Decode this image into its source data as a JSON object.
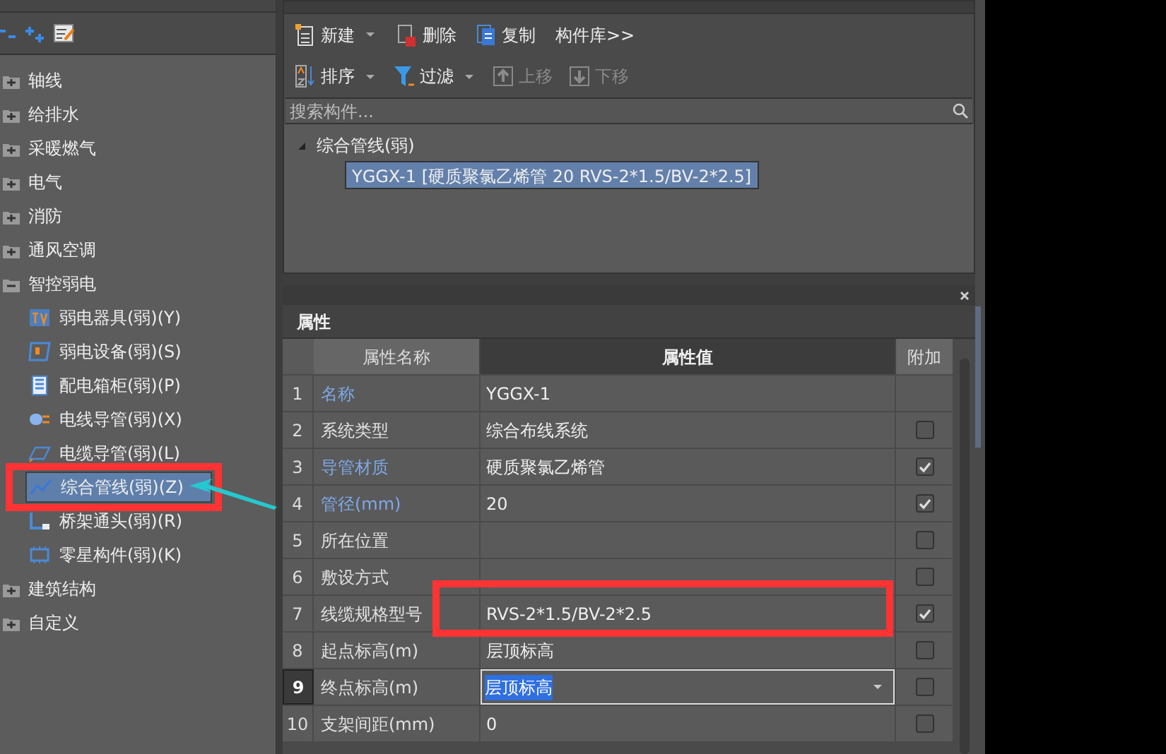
{
  "nav_toolbar": {
    "tools": [
      {
        "kind": "collapse"
      },
      {
        "kind": "expand"
      },
      {
        "kind": "edit"
      }
    ]
  },
  "nav_tree": [
    {
      "label": "轴线",
      "expanded": false
    },
    {
      "label": "给排水",
      "expanded": false
    },
    {
      "label": "采暖燃气",
      "expanded": false
    },
    {
      "label": "电气",
      "expanded": false
    },
    {
      "label": "消防",
      "expanded": false
    },
    {
      "label": "通风空调",
      "expanded": false
    },
    {
      "label": "智控弱电",
      "expanded": true,
      "children": [
        {
          "label": "弱电器具(弱)(Y)",
          "selected": false
        },
        {
          "label": "弱电设备(弱)(S)",
          "selected": false
        },
        {
          "label": "配电箱柜(弱)(P)",
          "selected": false
        },
        {
          "label": "电线导管(弱)(X)",
          "selected": false
        },
        {
          "label": "电缆导管(弱)(L)",
          "selected": false
        },
        {
          "label": "综合管线(弱)(Z)",
          "selected": true
        },
        {
          "label": "桥架通头(弱)(R)",
          "selected": false
        },
        {
          "label": "零星构件(弱)(K)",
          "selected": false
        }
      ]
    },
    {
      "label": "建筑结构",
      "expanded": false
    },
    {
      "label": "自定义",
      "expanded": false
    }
  ],
  "component_toolbar": {
    "row_1": [
      {
        "label": "新建",
        "dropdown": true,
        "disabled": false
      },
      {
        "label": "删除",
        "dropdown": false,
        "disabled": false
      },
      {
        "label": "复制",
        "dropdown": false,
        "disabled": false
      },
      {
        "label": "构件库>>",
        "dropdown": false,
        "disabled": false
      }
    ],
    "row_2": [
      {
        "label": "排序",
        "dropdown": true,
        "disabled": false
      },
      {
        "label": "过滤",
        "dropdown": true,
        "disabled": false
      },
      {
        "label": "上移",
        "dropdown": false,
        "disabled": true
      },
      {
        "label": "下移",
        "dropdown": false,
        "disabled": true
      }
    ]
  },
  "component_search": {
    "placeholder": "搜索构件..."
  },
  "component_tree": {
    "label": "综合管线(弱)",
    "expanded": true,
    "children": [
      {
        "label": "YGGX-1 [硬质聚氯乙烯管 20 RVS-2*1.5/BV-2*2.5]",
        "selected": true
      }
    ]
  },
  "properties": {
    "title": "属性",
    "columns": [
      "属性名称",
      "属性值",
      "附加"
    ],
    "rows": [
      {
        "number": "1",
        "name": "名称",
        "linked": true,
        "value": "YGGX-1",
        "selected": false
      },
      {
        "number": "2",
        "name": "系统类型",
        "linked": false,
        "value": "综合布线系统",
        "checked": false,
        "selected": false
      },
      {
        "number": "3",
        "name": "导管材质",
        "linked": true,
        "value": "硬质聚氯乙烯管",
        "checked": true,
        "selected": false
      },
      {
        "number": "4",
        "name": "管径(mm)",
        "linked": true,
        "value": "20",
        "checked": true,
        "selected": false
      },
      {
        "number": "5",
        "name": "所在位置",
        "linked": false,
        "value": "",
        "checked": false,
        "selected": false
      },
      {
        "number": "6",
        "name": "敷设方式",
        "linked": false,
        "value": "",
        "checked": false,
        "selected": false
      },
      {
        "number": "7",
        "name": "线缆规格型号",
        "linked": false,
        "value": "RVS-2*1.5/BV-2*2.5",
        "checked": true,
        "selected": false
      },
      {
        "number": "8",
        "name": "起点标高(m)",
        "linked": false,
        "value": "层顶标高",
        "checked": false,
        "selected": false
      },
      {
        "number": "9",
        "name": "终点标高(m)",
        "linked": false,
        "value": "层顶标高",
        "checked": false,
        "selected": true
      },
      {
        "number": "10",
        "name": "支架间距(mm)",
        "linked": false,
        "value": "0",
        "checked": false,
        "selected": false
      }
    ]
  }
}
